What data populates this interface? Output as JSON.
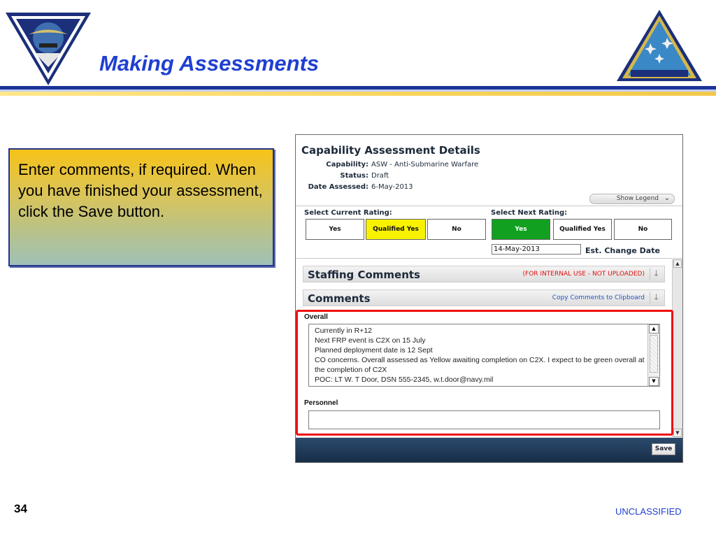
{
  "slide": {
    "title": "Making Assessments",
    "page_number": "34",
    "classification": "UNCLASSIFIED",
    "callout_text": "Enter comments, if required. When you have finished your assessment, click the Save button."
  },
  "logos": {
    "left": "naval-air-force-atlantic-seal",
    "right": "naval-air-force-pacific-seal"
  },
  "screenshot": {
    "title": "Capability Assessment Details",
    "fields": [
      {
        "label": "Capability:",
        "value": "ASW - Anti-Submarine Warfare"
      },
      {
        "label": "Status:",
        "value": "Draft"
      },
      {
        "label": "Date Assessed:",
        "value": "6-May-2013"
      }
    ],
    "legend_button": "Show Legend",
    "current_rating": {
      "label": "Select Current Rating:",
      "options": [
        "Yes",
        "Qualified Yes",
        "No"
      ],
      "selected": "Qualified Yes"
    },
    "next_rating": {
      "label": "Select Next Rating:",
      "options": [
        "Yes",
        "Qualified Yes",
        "No"
      ],
      "selected": "Yes"
    },
    "change_date_value": "14-May-2013",
    "change_date_label": "Est. Change Date",
    "staffing_panel": {
      "title": "Staffing Comments",
      "note": "(FOR INTERNAL USE - NOT UPLOADED)"
    },
    "comments_panel": {
      "title": "Comments",
      "link": "Copy Comments to Clipboard"
    },
    "overall": {
      "label": "Overall",
      "text": "Currently in R+12\nNext FRP event is C2X on 15 July\nPlanned deployment date is 12 Sept\nCO concerns. Overall assessed as Yellow awaiting completion on C2X. I expect to be green overall at the completion of C2X\nPOC: LT W. T Door, DSN 555-2345,  w.t.door@navy.mil"
    },
    "personnel": {
      "label": "Personnel",
      "text": ""
    },
    "save_label": "Save"
  },
  "colors": {
    "title_blue": "#1f3fd1",
    "highlight_red": "#ee1010",
    "rating_yellow": "#f8f200",
    "rating_green": "#12a020"
  }
}
